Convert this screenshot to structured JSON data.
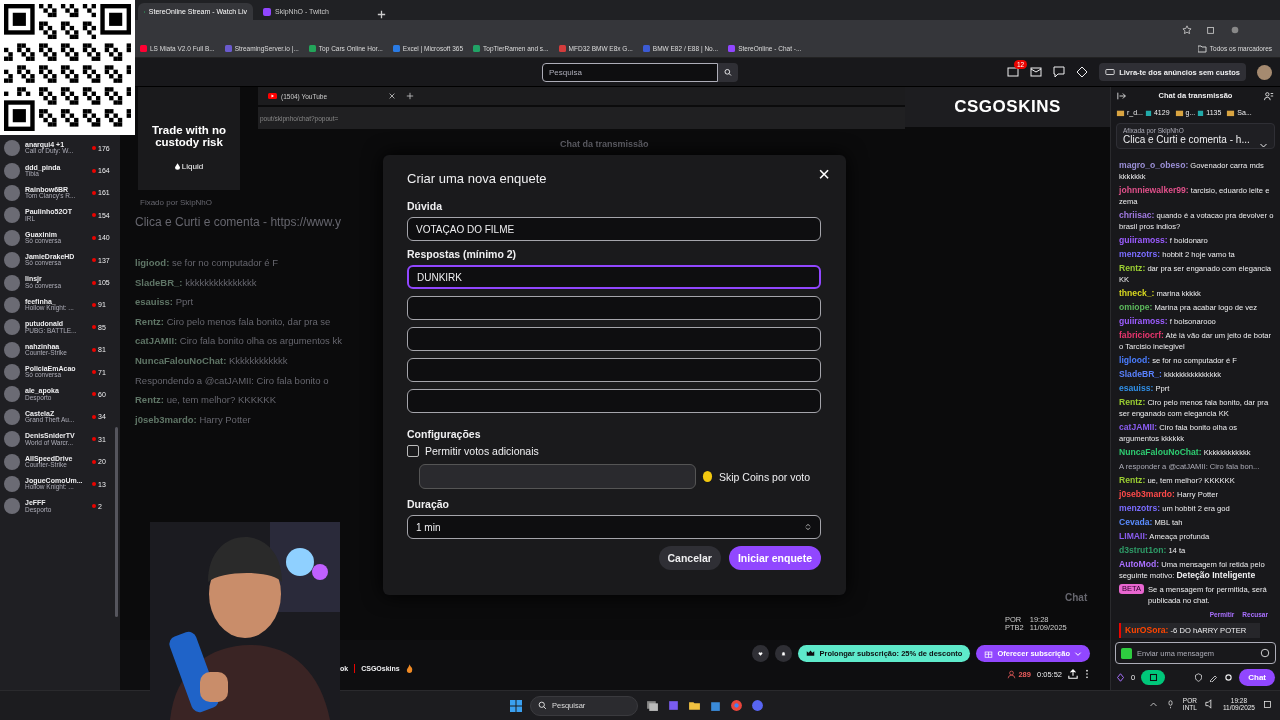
{
  "browser": {
    "tabs": [
      {
        "title": "StereOnline Stream - Watch Liv",
        "selected": true
      },
      {
        "title": "SkipNhO - Twitch",
        "selected": false
      }
    ],
    "bookmarks": [
      "LS Miata V2.0 Full B...",
      "StreamingServer.io |...",
      "Top Cars Online Hor...",
      "Excel | Microsoft 365",
      "TopTierRamen and s...",
      "MFD32 BMW E8x G...",
      "BMW E82 / E88 | No...",
      "StereOnline - Chat -..."
    ],
    "all_bookmarks": "Todos os marcadores"
  },
  "nav": {
    "search_placeholder": "Pesquisa",
    "notifications": "12",
    "promo": "Livra-te dos anúncios sem custos"
  },
  "sidebar": {
    "channels": [
      {
        "name": "anarqui4 +1",
        "category": "Call of Duty: W...",
        "viewers": "176"
      },
      {
        "name": "ddd_pinda",
        "category": "Tibia",
        "viewers": "164"
      },
      {
        "name": "Rainbow6BR",
        "category": "Tom Clancy's R...",
        "viewers": "161"
      },
      {
        "name": "Paulinho52OT",
        "category": "IRL",
        "viewers": "154"
      },
      {
        "name": "Guaxinim",
        "category": "Só conversa",
        "viewers": "140"
      },
      {
        "name": "JamieDrakeHD",
        "category": "Só conversa",
        "viewers": "137"
      },
      {
        "name": "linsjr",
        "category": "Só conversa",
        "viewers": "105"
      },
      {
        "name": "feefinha_",
        "category": "Hollow Knight: ...",
        "viewers": "91"
      },
      {
        "name": "putudonald",
        "category": "PUBG: BATTLE...",
        "viewers": "85"
      },
      {
        "name": "nahzinhaa",
        "category": "Counter-Strike",
        "viewers": "81"
      },
      {
        "name": "PoliciaEmAcao",
        "category": "Só conversa",
        "viewers": "71"
      },
      {
        "name": "ale_apoka",
        "category": "Desporto",
        "viewers": "60"
      },
      {
        "name": "CastelaZ",
        "category": "Grand Theft Au...",
        "viewers": "34"
      },
      {
        "name": "DenisSniderTV",
        "category": "World of Warcr...",
        "viewers": "31"
      },
      {
        "name": "AllSpeedDrive",
        "category": "Counter-Strike",
        "viewers": "20"
      },
      {
        "name": "JogueComoUm...",
        "category": "Hollow Knight: ...",
        "viewers": "13"
      },
      {
        "name": "JeFFF",
        "category": "Desporto",
        "viewers": "2"
      }
    ]
  },
  "stream": {
    "ad_headline": "Trade with no custody risk",
    "ad_brand": "Liquid",
    "inner_tab": "(1504) YouTube",
    "inner_url": "pout/skipnho/chat?popout=",
    "banner": "CSGOSKINS",
    "bg_chat_title": "Chat da transmissão",
    "bg_pinned": "Fixado por SkipNhO",
    "bg_pinned_text": "Clica e Curti e comenta - https://www.y",
    "bg_lines": [
      {
        "user": "ligiood:",
        "text": "se for no computador é F"
      },
      {
        "user": "SladeBR_:",
        "text": "kkkkkkkkkkkkkkk"
      },
      {
        "user": "esauiss:",
        "text": "Pprt"
      },
      {
        "user": "Rentz:",
        "text": "Ciro pelo menos fala bonito, dar pra se"
      },
      {
        "user": "catJAMII:",
        "text": "Ciro fala bonito olha os argumentos kk"
      },
      {
        "user": "NuncaFalouNoChat:",
        "text": "Kkkkkkkkkkkk"
      },
      {
        "text": "Respondendo a @catJAMII: Ciro fala bonito o"
      },
      {
        "user": "Rentz:",
        "text": "ue, tem melhor? KKKKKK"
      },
      {
        "user": "j0seb3mardo:",
        "text": "Harry Potter"
      }
    ],
    "inner_tray": [
      "POR",
      "PTB2"
    ],
    "inner_time": "19:28",
    "inner_date": "11/09/2025",
    "inner_chat_button": "Chat"
  },
  "poll": {
    "title": "Criar uma nova enquete",
    "close": "×",
    "question_label": "Dúvida",
    "question": "VOTAÇAO DO FILME",
    "answers_label": "Respostas (mínimo 2)",
    "answers": [
      {
        "value": "DUNKIRK",
        "focused": true
      },
      {
        "focused": false
      },
      {
        "focused": false
      },
      {
        "focused": false
      },
      {
        "focused": false
      }
    ],
    "settings_label": "Configurações",
    "extra_votes": {
      "label": "Permitir votos adicionais",
      "checked": false
    },
    "coins_label": "Skip Coins por voto",
    "duration_label": "Duração",
    "duration": "1 min",
    "cancel": "Cancelar",
    "start": "Iniciar enquete"
  },
  "stream_info": {
    "title_tail": "ok",
    "sponsor": "CSGOskins",
    "extend": "Prolongar subscrição: 25% de desconto",
    "gift": "Oferecer subscrição",
    "viewers": "289",
    "uptime": "0:05:52"
  },
  "chat": {
    "title": "Chat da transmissão",
    "gifters": [
      {
        "name": "r_d...",
        "count": "4129"
      },
      {
        "name": "g...",
        "count": "1135"
      },
      {
        "name": "Sa..."
      }
    ],
    "pinned_by": "Afixada por SkipNhO",
    "pinned_text": "Clica e Curti e comenta - h...",
    "messages": [
      {
        "kind": "msg",
        "user": "magro_o_obeso:",
        "color": "#9a8fd6",
        "text": "Govenador carra mds kkkkkkk"
      },
      {
        "kind": "msg",
        "user": "johnniewalker99:",
        "color": "#e0508a",
        "text": "tarcisio, eduardo leite e zema"
      },
      {
        "kind": "msg",
        "user": "chriisac:",
        "color": "#a07ae0",
        "text": "quando é a votacao pra devolver o brasil pros indios?"
      },
      {
        "kind": "msg",
        "user": "guiiramoss:",
        "color": "#9b5cff",
        "text": "f boldonaro"
      },
      {
        "kind": "msg",
        "user": "menzotrs:",
        "color": "#7a6cff",
        "text": "hobbit 2 hoje vamo ta"
      },
      {
        "kind": "msg",
        "user": "Rentz:",
        "color": "#9acd32",
        "text": "dar pra ser enganado com elegancia KK"
      },
      {
        "kind": "msg",
        "user": "thneck_:",
        "color": "#d8d820",
        "text": "marina kkkkk"
      },
      {
        "kind": "msg",
        "user": "omiope:",
        "color": "#5cb85c",
        "text": "Marina pra acabar logo de vez"
      },
      {
        "kind": "msg",
        "user": "guiiramoss:",
        "color": "#9b5cff",
        "text": "f bolsonarooo"
      },
      {
        "kind": "msg",
        "user": "fabriciocrf:",
        "color": "#e8356e",
        "text": "Até lá vão dar um jeito de botar o Tarcisio inelegivel"
      },
      {
        "kind": "msg",
        "user": "liglood:",
        "color": "#4a7dff",
        "text": "se for no computador é F"
      },
      {
        "kind": "msg",
        "user": "SladeBR_:",
        "color": "#5a82ff",
        "text": "kkkkkkkkkkkkkkk"
      },
      {
        "kind": "msg",
        "user": "esauiss:",
        "color": "#2f8fe8",
        "text": "Pprt"
      },
      {
        "kind": "msg",
        "user": "Rentz:",
        "color": "#9acd32",
        "text": "Ciro pelo menos fala bonito, dar pra ser enganado com elegancia KK"
      },
      {
        "kind": "msg",
        "user": "catJAMII:",
        "color": "#8a5cf0",
        "text": "Ciro fala bonito olha os argumentos kkkkkk"
      },
      {
        "kind": "msg",
        "user": "NuncaFalouNoChat:",
        "color": "#2ecc71",
        "text": "Kkkkkkkkkkkk"
      },
      {
        "kind": "reply",
        "text": "A responder a @catJAMII: Ciro fala bon..."
      },
      {
        "kind": "msg",
        "user": "Rentz:",
        "color": "#9acd32",
        "text": "ue, tem melhor? KKKKKK"
      },
      {
        "kind": "msg",
        "user": "j0seb3mardo:",
        "color": "#ff4a4a",
        "text": "Harry Potter"
      },
      {
        "kind": "msg",
        "user": "menzotrs:",
        "color": "#7a6cff",
        "text": "um hobbit 2 era god"
      },
      {
        "kind": "msg",
        "user": "Cevada:",
        "color": "#5a8cff",
        "text": "MBL tah"
      },
      {
        "kind": "msg",
        "user": "LIMAII:",
        "color": "#8a5cf0",
        "text": "Ameaça profunda"
      },
      {
        "kind": "msg",
        "user": "d3strut1on:",
        "color": "#2e9b67",
        "text": "14 ta"
      },
      {
        "kind": "automod",
        "user": "AutoMod:",
        "color": "#a970ff",
        "text": "Uma mensagem foi retida pelo seguinte motivo: **Deteção Inteligente**",
        "beta": "BETA",
        "note": "Se a mensagem for permitida, será publicada no chat.",
        "allow": "Permitir",
        "deny": "Recusar"
      },
      {
        "kind": "held",
        "user": "KurOSora:",
        "color": "#ff4500",
        "text": "-6 DO hARRY POTER"
      }
    ],
    "input_placeholder": "Enviar uma mensagem",
    "points": "0",
    "send": "Chat"
  },
  "taskbar": {
    "search_placeholder": "Pesquisar",
    "lang": [
      "POR",
      "INTL"
    ],
    "time": "19:28",
    "date": "11/09/2025"
  }
}
